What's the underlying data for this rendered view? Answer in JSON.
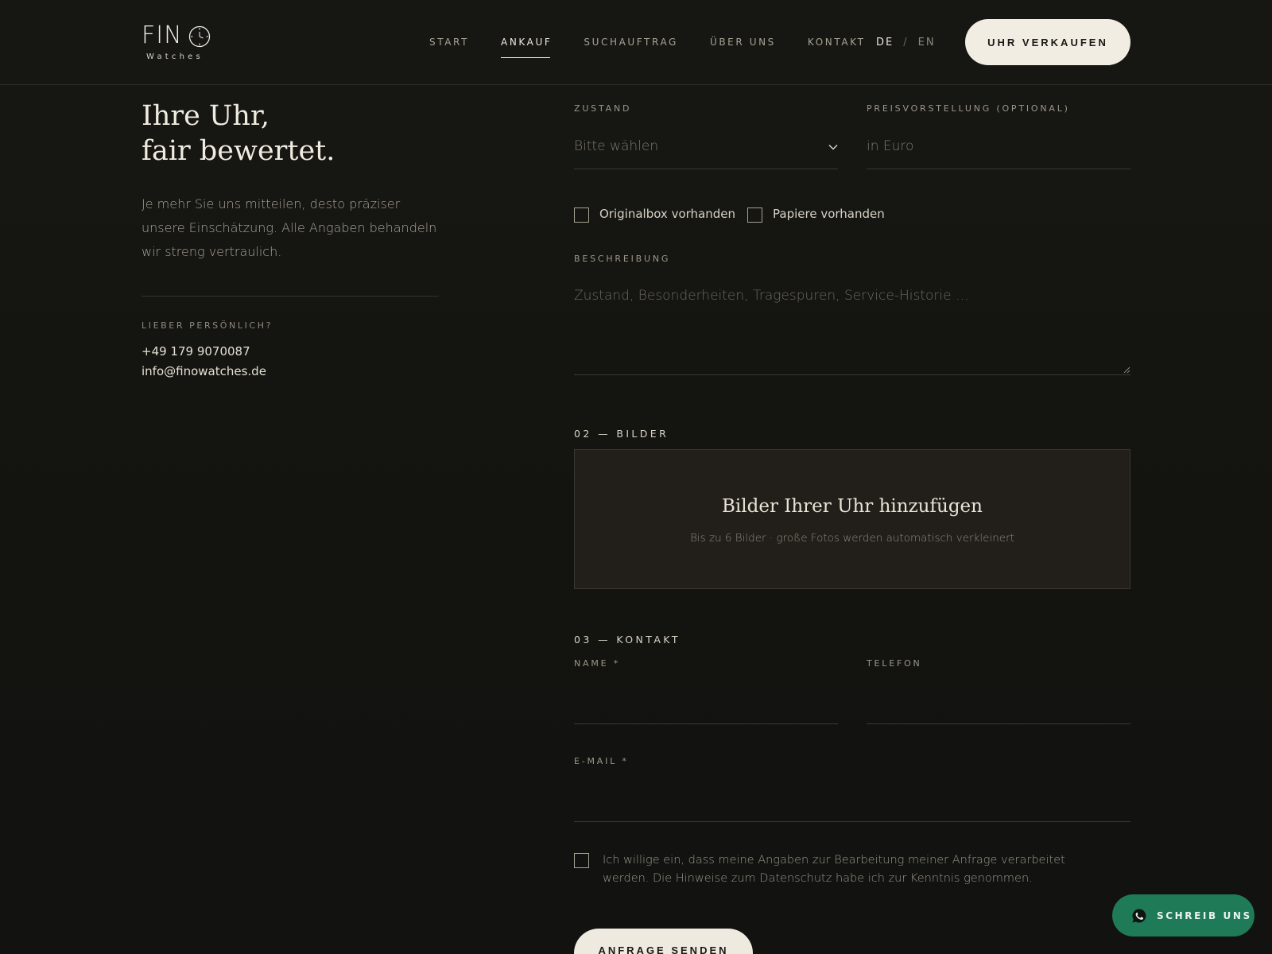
{
  "header": {
    "logo_main": "FIN",
    "logo_sub": "Watches",
    "nav": [
      {
        "label": "START",
        "active": false
      },
      {
        "label": "ANKAUF",
        "active": true
      },
      {
        "label": "SUCHAUFTRAG",
        "active": false
      },
      {
        "label": "ÜBER UNS",
        "active": false
      },
      {
        "label": "KONTAKT",
        "active": false
      }
    ],
    "lang_de": "DE",
    "lang_sep": "/",
    "lang_en": "EN",
    "cta_label": "UHR VERKAUFEN"
  },
  "left": {
    "title_line1": "Ihre Uhr,",
    "title_line2": "fair bewertet.",
    "text": "Je mehr Sie uns mitteilen, desto präziser unsere Einschätzung. Alle Angaben behandeln wir streng vertraulich.",
    "contact_label": "LIEBER PERSÖNLICH?",
    "phone": "+49 179 9070087",
    "email": "info@finowatches.de"
  },
  "form": {
    "condition_label": "ZUSTAND",
    "condition_value": "Bitte wählen",
    "price_label": "PREISVORSTELLUNG (OPTIONAL)",
    "price_placeholder": "in Euro",
    "box_label": "Originalbox vorhanden",
    "papers_label": "Papiere vorhanden",
    "description_label": "BESCHREIBUNG",
    "description_placeholder": "Zustand, Besonderheiten, Tragespuren, Service-Historie …",
    "images_heading": "02 — BILDER",
    "dropzone_title": "Bilder Ihrer Uhr hinzufügen",
    "dropzone_sub": "Bis zu 6 Bilder · große Fotos werden automatisch verkleinert",
    "contact_heading": "03 — KONTAKT",
    "name_label": "NAME *",
    "phone_label": "TELEFON",
    "email_label": "E-MAIL *",
    "consent_text": "Ich willige ein, dass meine Angaben zur Bearbeitung meiner Anfrage verarbeitet werden. Die Hinweise zum Datenschutz habe ich zur Kenntnis genommen.",
    "submit_label": "ANFRAGE SENDEN"
  },
  "whatsapp": {
    "label": "SCHREIB UNS",
    "color": "#1f7a57"
  },
  "colors": {
    "accent": "#f1ede2",
    "background": "#141411"
  }
}
